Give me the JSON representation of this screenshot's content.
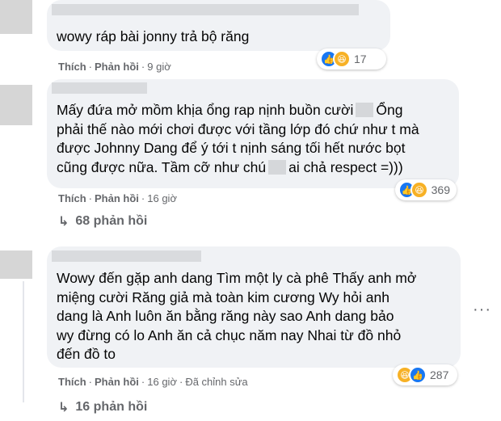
{
  "comments": [
    {
      "text": "wowy ráp bài jonny trả bộ răng",
      "like_label": "Thích",
      "reply_label": "Phản hồi",
      "time": "9 giờ",
      "reaction_count": "17",
      "reaction_icons": [
        "like-icon",
        "haha-icon"
      ]
    },
    {
      "text_line1": "Mấy đứa mở mồm khịa ổng rap nịnh buồn cười",
      "text_line1b": "Ổng",
      "text_line2": "phải thế nào mới chơi được với tầng lớp đó chứ như t mà",
      "text_line3": "được Johnny Dang để ý tới t nịnh sáng tối hết nước bọt",
      "text_line4a": "cũng được nữa. Tầm cỡ như chú",
      "text_line4b": "ai chả respect =)))",
      "like_label": "Thích",
      "reply_label": "Phản hồi",
      "time": "16 giờ",
      "reaction_count": "369",
      "reaction_icons": [
        "like-icon",
        "haha-icon"
      ],
      "replies_label": "68 phản hồi"
    },
    {
      "text": "Wowy đến gặp anh dang Tìm một ly cà phê Thấy anh mở\nmiệng cười Răng giả mà toàn kim cương Wy hỏi anh\ndang là Anh luôn ăn bằng răng này sao Anh dang bảo\nwy đừng có lo Anh ăn cả chục năm nay Nhai từ đồ nhỏ\nđến đồ to",
      "like_label": "Thích",
      "reply_label": "Phản hồi",
      "time": "16 giờ",
      "edited": "Đã chỉnh sửa",
      "reaction_count": "287",
      "reaction_icons": [
        "haha-icon",
        "like-icon"
      ],
      "replies_label": "16 phản hồi",
      "more_label": "···"
    }
  ],
  "colors": {
    "bubble": "#f0f2f5",
    "meta": "#65676b",
    "like": "#1877f2",
    "haha": "#f7b125"
  }
}
